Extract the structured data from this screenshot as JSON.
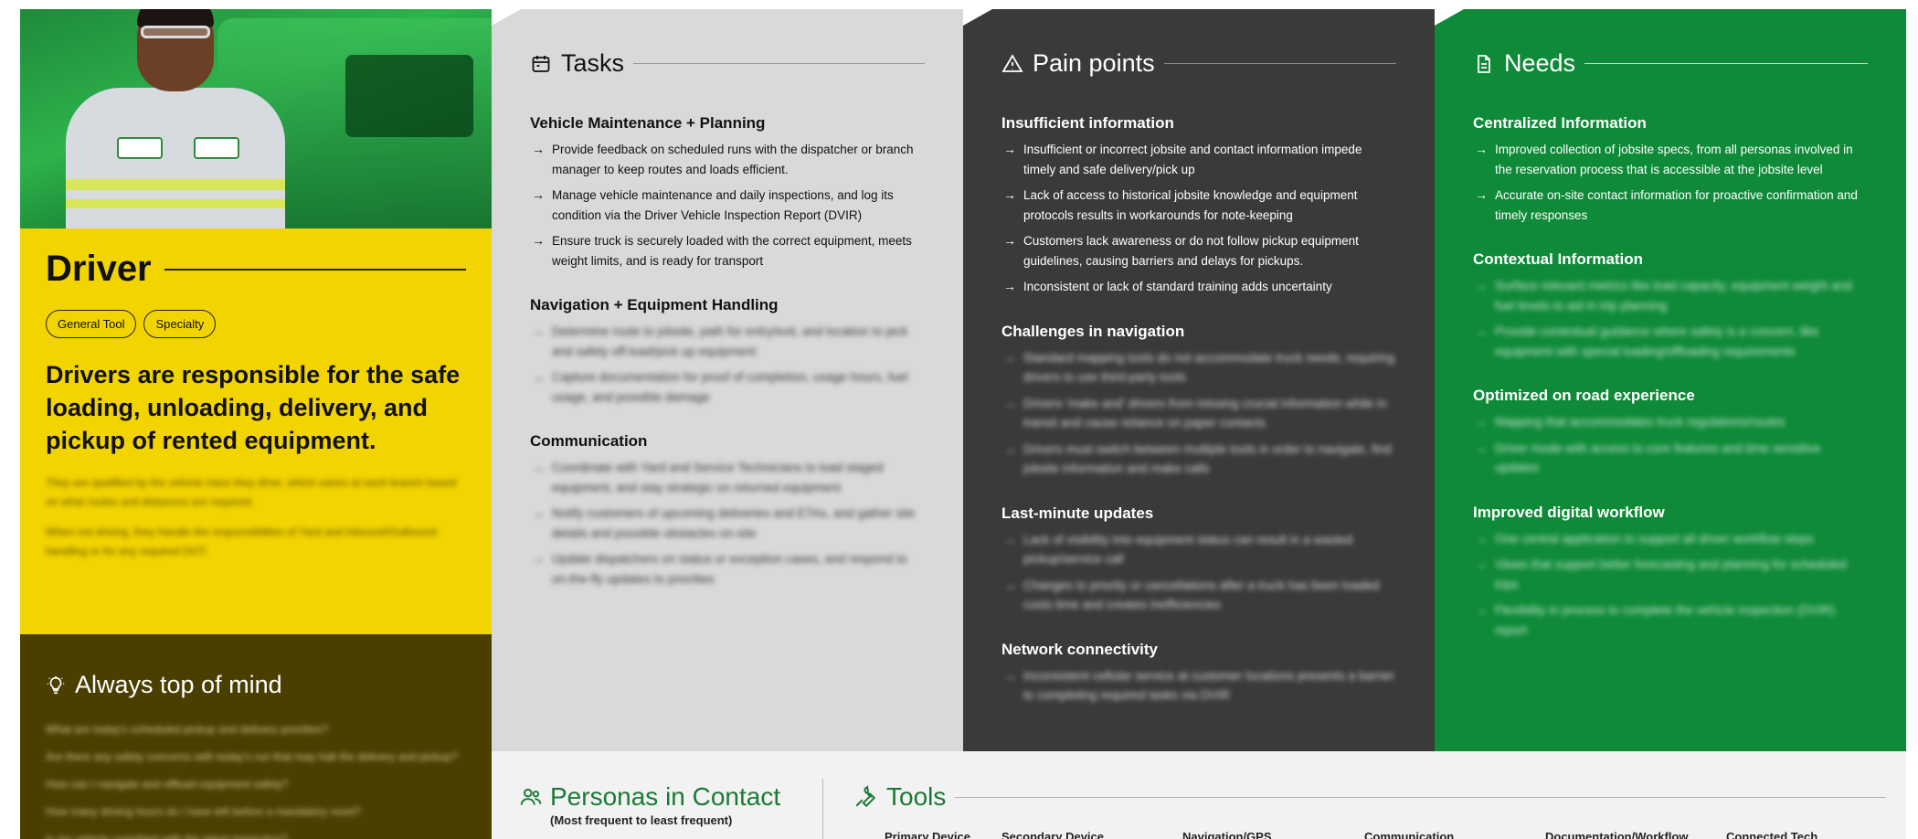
{
  "driver": {
    "title": "Driver",
    "tags": [
      "General Tool",
      "Specialty"
    ],
    "lead": "Drivers are responsible for the safe loading, unloading, delivery, and pickup of rented equipment.",
    "para1": "They are qualified by the vehicle class they drive, which varies at each branch based on what routes and distances are required.",
    "para2": "When not driving, they handle the responsibilities of Yard and Inbound/Outbound handling or for any required DOT."
  },
  "always_top_of_mind": {
    "title": "Always top of mind",
    "items": [
      "What are today's scheduled pickup and delivery priorities?",
      "Are there any safety concerns with today's run that may halt the delivery and pickup?",
      "How can I navigate and offload equipment safely?",
      "How many driving hours do I have left before a mandatory reset?",
      "Is my vehicle compliant with the latest inspection?"
    ]
  },
  "tasks": {
    "title": "Tasks",
    "sections": [
      {
        "title": "Vehicle Maintenance + Planning",
        "blurred": false,
        "items": [
          "Provide feedback on scheduled runs with the dispatcher or branch manager to keep routes and loads efficient.",
          "Manage vehicle maintenance and daily inspections, and log its condition via the Driver Vehicle Inspection Report (DVIR)",
          "Ensure truck is securely loaded with the correct equipment, meets weight limits, and is ready for transport"
        ]
      },
      {
        "title": "Navigation + Equipment Handling",
        "blurred": true,
        "items": [
          "Determine route to jobsite, path for entry/exit, and location to pick and safely off-load/pick up equipment",
          "Capture documentation for proof of completion, usage hours, fuel usage, and possible damage"
        ]
      },
      {
        "title": "Communication",
        "blurred": true,
        "items": [
          "Coordinate with Yard and Service Technicians to load staged equipment, and stay strategic on returned equipment",
          "Notify customers of upcoming deliveries and ETAs, and gather site details and possible obstacles on-site",
          "Update dispatchers on status or exception cases, and respond to on-the-fly updates to priorities"
        ]
      }
    ]
  },
  "pain_points": {
    "title": "Pain points",
    "sections": [
      {
        "title": "Insufficient information",
        "blurred": false,
        "items": [
          "Insufficient or incorrect jobsite and contact information impede timely and safe delivery/pick up",
          "Lack of access to historical jobsite knowledge and equipment protocols results in workarounds for note-keeping",
          "Customers lack awareness or do not follow pickup equipment guidelines, causing barriers and delays for pickups.",
          "Inconsistent or lack of standard training adds uncertainty"
        ]
      },
      {
        "title": "Challenges in navigation",
        "blurred": true,
        "items": [
          "Standard mapping tools do not accommodate truck needs, requiring drivers to use third-party tools",
          "Drivers 'make and' drivers from missing crucial information while in transit and cause reliance on paper contacts",
          "Drivers must switch between multiple tools in order to navigate, find jobsite information and make calls"
        ]
      },
      {
        "title": "Last-minute updates",
        "blurred": true,
        "items": [
          "Lack of visibility into equipment status can result in a wasted pickup/service call",
          "Changes to priority or cancellations after a truck has been loaded costs time and creates inefficiencies"
        ]
      },
      {
        "title": "Network connectivity",
        "blurred": true,
        "items": [
          "Inconsistent cellular service at customer locations presents a barrier to completing required tasks via DVIR"
        ]
      }
    ]
  },
  "needs": {
    "title": "Needs",
    "sections": [
      {
        "title": "Centralized Information",
        "blurred": false,
        "items": [
          "Improved collection of jobsite specs, from all personas involved in the reservation process that is accessible at the jobsite level",
          "Accurate on-site contact information for proactive confirmation and timely responses"
        ]
      },
      {
        "title": "Contextual Information",
        "blurred": true,
        "items": [
          "Surface relevant metrics like load capacity, equipment weight and fuel levels to aid in trip planning",
          "Provide contextual guidance where safety is a concern, like equipment with special loading/offloading requirements"
        ]
      },
      {
        "title": "Optimized on road experience",
        "blurred": true,
        "items": [
          "Mapping that accommodates truck regulations/routes",
          "Driver mode with access to core features and time sensitive updates"
        ]
      },
      {
        "title": "Improved digital workflow",
        "blurred": true,
        "items": [
          "One central application to support all driver workflow steps",
          "Views that support better forecasting and planning for scheduled trips",
          "Flexibility in process to complete the vehicle inspection (DVIR) report"
        ]
      }
    ]
  },
  "personas": {
    "title": "Personas in Contact",
    "subtitle": "(Most frequent to least frequent)"
  },
  "tools": {
    "title": "Tools",
    "columns": [
      "Primary Device",
      "Secondary Device",
      "Navigation/GPS",
      "Communication",
      "Documentation/Workflow",
      "Connected Tech"
    ]
  },
  "colors": {
    "driver_yellow": "#f2d400",
    "tasks_gray": "#d9d9d9",
    "pain_dark": "#3a3a3a",
    "needs_green": "#0e8a38",
    "atm_olive": "#4a3f00",
    "accent_green": "#1b7a35"
  },
  "icons": [
    "calendar-icon",
    "warning-icon",
    "document-icon",
    "lightbulb-icon",
    "people-icon",
    "wrench-icon",
    "arrow-icon"
  ]
}
